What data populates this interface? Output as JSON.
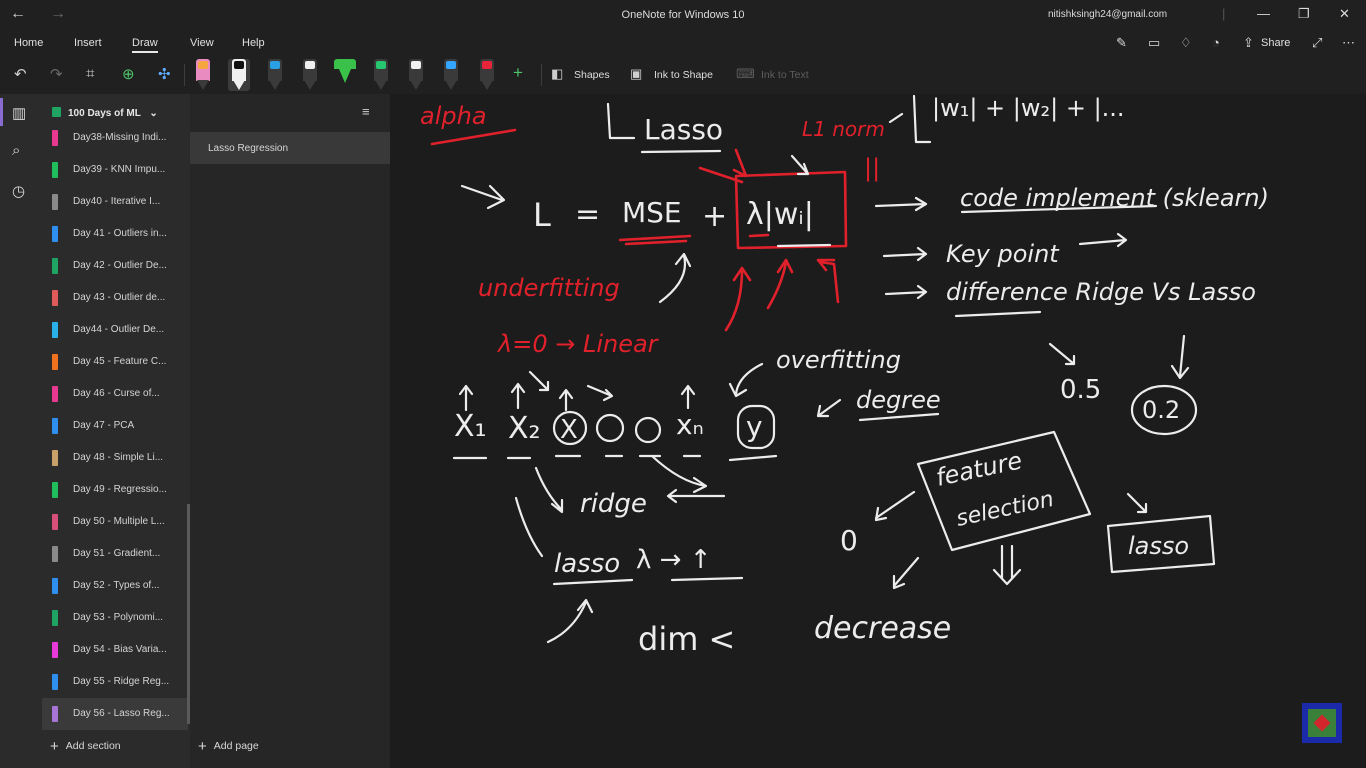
{
  "titlebar": {
    "app_title": "OneNote for Windows 10",
    "account": "nitishksingh24@gmail.com",
    "back_icon": "back-arrow-icon",
    "forward_icon": "forward-arrow-icon"
  },
  "ribbon": {
    "tabs": [
      "Home",
      "Insert",
      "Draw",
      "View",
      "Help"
    ],
    "active_tab": "Draw",
    "share_label": "Share"
  },
  "toolbar": {
    "shapes_label": "Shapes",
    "ink_to_shape_label": "Ink to Shape",
    "ink_to_text_label": "Ink to Text",
    "pen_colors": [
      "#2a2a2a",
      "#f0f0f0",
      "#2b9fe3",
      "#f0f0f0",
      "#39c14a",
      "#26c76e",
      "#f0f0f0",
      "#35a6ff",
      "#e8243a"
    ]
  },
  "notebook": {
    "name": "100 Days of ML",
    "sections": [
      {
        "label": "Day38-Missing Indi...",
        "color": "#e8388f"
      },
      {
        "label": "Day39 - KNN Impu...",
        "color": "#1fbf5b"
      },
      {
        "label": "Day40 - Iterative I...",
        "color": "#8a8a8a"
      },
      {
        "label": "Day 41 - Outliers in...",
        "color": "#2f8ff0"
      },
      {
        "label": "Day 42 - Outlier De...",
        "color": "#1fa463"
      },
      {
        "label": "Day 43 - Outlier de...",
        "color": "#e05a5a"
      },
      {
        "label": "Day44 - Outlier De...",
        "color": "#2ab0e8"
      },
      {
        "label": "Day 45 - Feature C...",
        "color": "#f0721f"
      },
      {
        "label": "Day 46 - Curse of...",
        "color": "#e8388f"
      },
      {
        "label": "Day 47 - PCA",
        "color": "#2f8ff0"
      },
      {
        "label": "Day 48 - Simple Li...",
        "color": "#c9a06a"
      },
      {
        "label": "Day 49 - Regressio...",
        "color": "#1fbf5b"
      },
      {
        "label": "Day 50 - Multiple L...",
        "color": "#d8507a"
      },
      {
        "label": "Day 51 - Gradient...",
        "color": "#8a8a8a"
      },
      {
        "label": "Day 52 - Types of...",
        "color": "#2f8ff0"
      },
      {
        "label": "Day 53 - Polynomi...",
        "color": "#1fa463"
      },
      {
        "label": "Day 54 - Bias Varia...",
        "color": "#e83ad8"
      },
      {
        "label": "Day 55 - Ridge Reg...",
        "color": "#2f8ff0"
      },
      {
        "label": "Day 56 - Lasso Reg...",
        "color": "#a775d6"
      }
    ],
    "selected_section_index": 18,
    "add_section_label": "Add section"
  },
  "pages": {
    "items": [
      "Lasso Regression"
    ],
    "add_page_label": "Add page"
  },
  "canvas": {
    "alpha": "alpha",
    "lasso_heading": "Lasso",
    "l1_norm": "L1 norm",
    "norm_expr": "|w₁| + |w₂| + |...",
    "loss_L": "L",
    "loss_eq": "=",
    "loss_mse": "MSE",
    "loss_plus": "+",
    "loss_penalty": "λ|wᵢ|",
    "pipes": "||",
    "code_implement": "code implement (sklearn)",
    "key_point": "Key point",
    "difference": "difference Ridge Vs Lasso",
    "underfitting": "underfitting",
    "lambda_linear": "λ=0 → Linear",
    "overfitting": "overfitting",
    "val_05": "0.5",
    "val_02": "0.2",
    "x1": "X₁",
    "x2": "X₂",
    "x_circled": "X",
    "xn": "xₙ",
    "y": "y",
    "degree": "degree",
    "ridge": "ridge",
    "lasso_lower": "lasso",
    "lambda_up": "λ → ↑",
    "dim": "dim <",
    "zero": "0",
    "feature": "feature",
    "selection": "selection",
    "decrease": "decrease",
    "lasso_box": "lasso"
  }
}
